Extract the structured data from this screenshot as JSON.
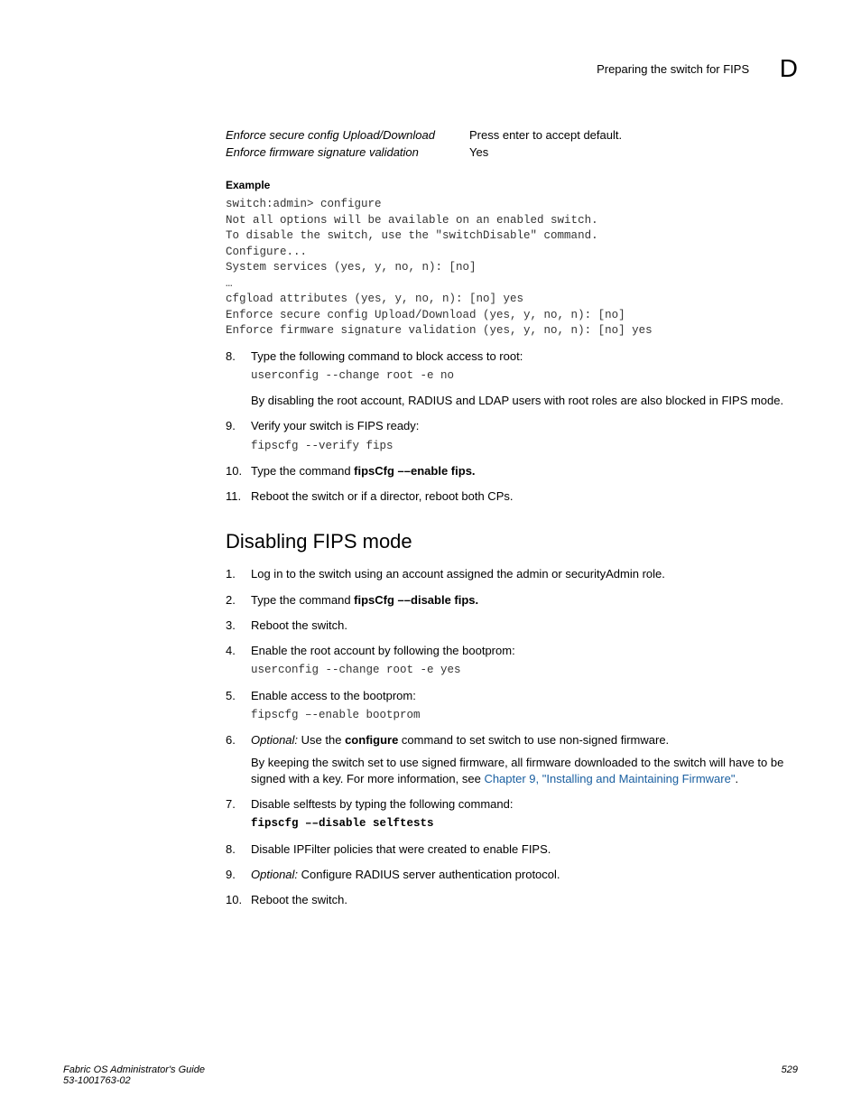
{
  "header": {
    "title": "Preparing the switch for FIPS",
    "letter": "D"
  },
  "options": [
    {
      "label": "Enforce secure config Upload/Download",
      "value": "Press enter to accept default."
    },
    {
      "label": "Enforce firmware signature validation",
      "value": "Yes"
    }
  ],
  "example": {
    "heading": "Example",
    "code": "switch:admin> configure\nNot all options will be available on an enabled switch.\nTo disable the switch, use the \"switchDisable\" command.\nConfigure...\nSystem services (yes, y, no, n): [no]\n…\ncfgload attributes (yes, y, no, n): [no] yes\nEnforce secure config Upload/Download (yes, y, no, n): [no]\nEnforce firmware signature validation (yes, y, no, n): [no] yes"
  },
  "steps1": {
    "s8": {
      "text": "Type the following command to block access to root:",
      "code": "userconfig --change root -e no",
      "note": "By disabling the root account, RADIUS and LDAP users with root roles are also blocked in FIPS mode."
    },
    "s9": {
      "text": "Verify your switch is FIPS ready:",
      "code": "fipscfg --verify fips"
    },
    "s10": {
      "prefix": "Type the command ",
      "cmd": "fipsCfg ––enable fips."
    },
    "s11": {
      "text": "Reboot the switch or if a director, reboot both CPs."
    }
  },
  "section2": {
    "heading": "Disabling FIPS mode",
    "s1": {
      "text": "Log in to the switch using an account assigned the admin or securityAdmin role."
    },
    "s2": {
      "prefix": "Type the command ",
      "cmd": "fipsCfg ––disable fips."
    },
    "s3": {
      "text": "Reboot the switch."
    },
    "s4": {
      "text": "Enable the root account by following the bootprom:",
      "code": "userconfig --change root -e yes"
    },
    "s5": {
      "text": "Enable access to the bootprom:",
      "code": "fipscfg –-enable bootprom"
    },
    "s6": {
      "optional": "Optional:",
      "t1": " Use the ",
      "cmd": "configure",
      "t2": " command to set switch to use non-signed firmware.",
      "note_a": "By keeping the switch set to use signed firmware, all firmware downloaded to the switch will have to be signed with a key. For more information, see ",
      "link": "Chapter 9, \"Installing and Maintaining Firmware\"",
      "note_b": "."
    },
    "s7": {
      "text": "Disable selftests by typing the following command:",
      "code": "fipscfg ––disable selftests"
    },
    "s8": {
      "text": "Disable IPFilter policies that were created to enable FIPS."
    },
    "s9": {
      "optional": "Optional:",
      "text": " Configure RADIUS server authentication protocol."
    },
    "s10": {
      "text": "Reboot the switch."
    }
  },
  "footer": {
    "line1": "Fabric OS Administrator's Guide",
    "line2": "53-1001763-02",
    "page": "529"
  }
}
